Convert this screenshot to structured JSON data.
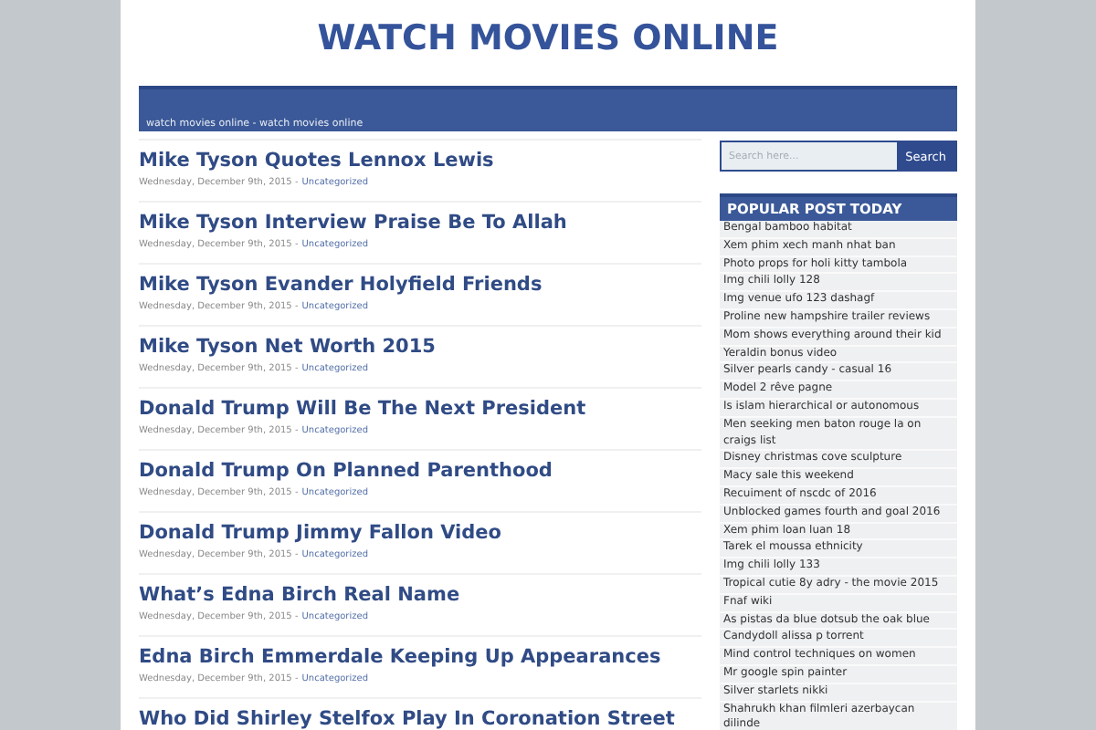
{
  "site_title": "WATCH MOVIES ONLINE",
  "header_bar": {
    "tagline": "watch movies online - watch movies online"
  },
  "posts": [
    {
      "title": "Mike Tyson Quotes Lennox Lewis",
      "date": "Wednesday, December 9th, 2015 -",
      "category": "Uncategorized"
    },
    {
      "title": "Mike Tyson Interview Praise Be To Allah",
      "date": "Wednesday, December 9th, 2015 -",
      "category": "Uncategorized"
    },
    {
      "title": "Mike Tyson Evander Holyfield Friends",
      "date": "Wednesday, December 9th, 2015 -",
      "category": "Uncategorized"
    },
    {
      "title": "Mike Tyson Net Worth 2015",
      "date": "Wednesday, December 9th, 2015 -",
      "category": "Uncategorized"
    },
    {
      "title": "Donald Trump Will Be The Next President",
      "date": "Wednesday, December 9th, 2015 -",
      "category": "Uncategorized"
    },
    {
      "title": "Donald Trump On Planned Parenthood",
      "date": "Wednesday, December 9th, 2015 -",
      "category": "Uncategorized"
    },
    {
      "title": "Donald Trump Jimmy Fallon Video",
      "date": "Wednesday, December 9th, 2015 -",
      "category": "Uncategorized"
    },
    {
      "title": "What’s Edna Birch Real Name",
      "date": "Wednesday, December 9th, 2015 -",
      "category": "Uncategorized"
    },
    {
      "title": "Edna Birch Emmerdale Keeping Up Appearances",
      "date": "Wednesday, December 9th, 2015 -",
      "category": "Uncategorized"
    },
    {
      "title": "Who Did Shirley Stelfox Play In Coronation Street"
    }
  ],
  "search": {
    "placeholder": "Search here...",
    "button": "Search"
  },
  "popular": {
    "heading": "POPULAR POST TODAY",
    "items": [
      "Bengal bamboo habitat",
      "Xem phim xech manh nhat ban",
      "Photo props for holi kitty tambola",
      "Img chili lolly 128",
      "Img venue ufo 123 dashagf",
      "Proline new hampshire trailer reviews",
      "Mom shows everything around their kid",
      "Yeraldin bonus video",
      "Silver pearls candy - casual 16",
      "Model 2 rêve pagne",
      "Is islam hierarchical or autonomous",
      "Men seeking men baton rouge la on craigs list",
      "Disney christmas cove sculpture",
      "Macy sale this weekend",
      "Recuiment of nscdc of 2016",
      "Unblocked games fourth and goal 2016",
      "Xem phim loan luan 18",
      "Tarek el moussa ethnicity",
      "Img chili lolly 133",
      "Tropical cutie 8y adry - the movie 2015",
      "Fnaf wiki",
      "As pistas da blue dotsub the oak blue",
      "Candydoll alissa p torrent",
      "Mind control techniques on women",
      "Mr google spin painter",
      "Silver starlets nikki",
      "Shahrukh khan filmleri azerbaycan dilinde"
    ]
  }
}
